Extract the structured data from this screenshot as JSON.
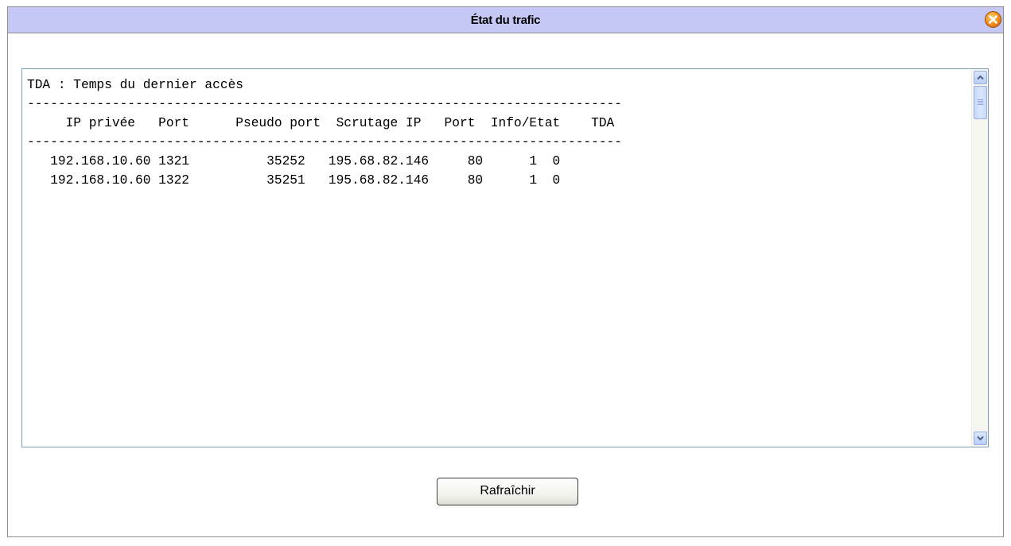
{
  "dialog": {
    "title": "État du trafic"
  },
  "console": {
    "legend": "TDA : Temps du dernier accès",
    "separator": "-----------------------------------------------------------------------------",
    "headers": {
      "ip_privee": "IP privée",
      "port": "Port",
      "pseudo_port": "Pseudo port",
      "scrutage_ip": "Scrutage IP",
      "port2": "Port",
      "info_etat": "Info/Etat",
      "tda": "TDA"
    },
    "rows": [
      {
        "ip_privee": "192.168.10.60",
        "port": "1321",
        "pseudo_port": "35252",
        "scrutage_ip": "195.68.82.146",
        "port2": "80",
        "info": "1",
        "etat": "0"
      },
      {
        "ip_privee": "192.168.10.60",
        "port": "1322",
        "pseudo_port": "35251",
        "scrutage_ip": "195.68.82.146",
        "port2": "80",
        "info": "1",
        "etat": "0"
      }
    ]
  },
  "actions": {
    "refresh_label": "Rafraîchir"
  },
  "icons": {
    "close": "close-icon",
    "scroll_up": "arrow-up-icon",
    "scroll_down": "arrow-down-icon"
  },
  "colors": {
    "titlebar": "#c5c8f5",
    "close_button": "#f08a1c",
    "frame_border": "#7f9db9"
  }
}
